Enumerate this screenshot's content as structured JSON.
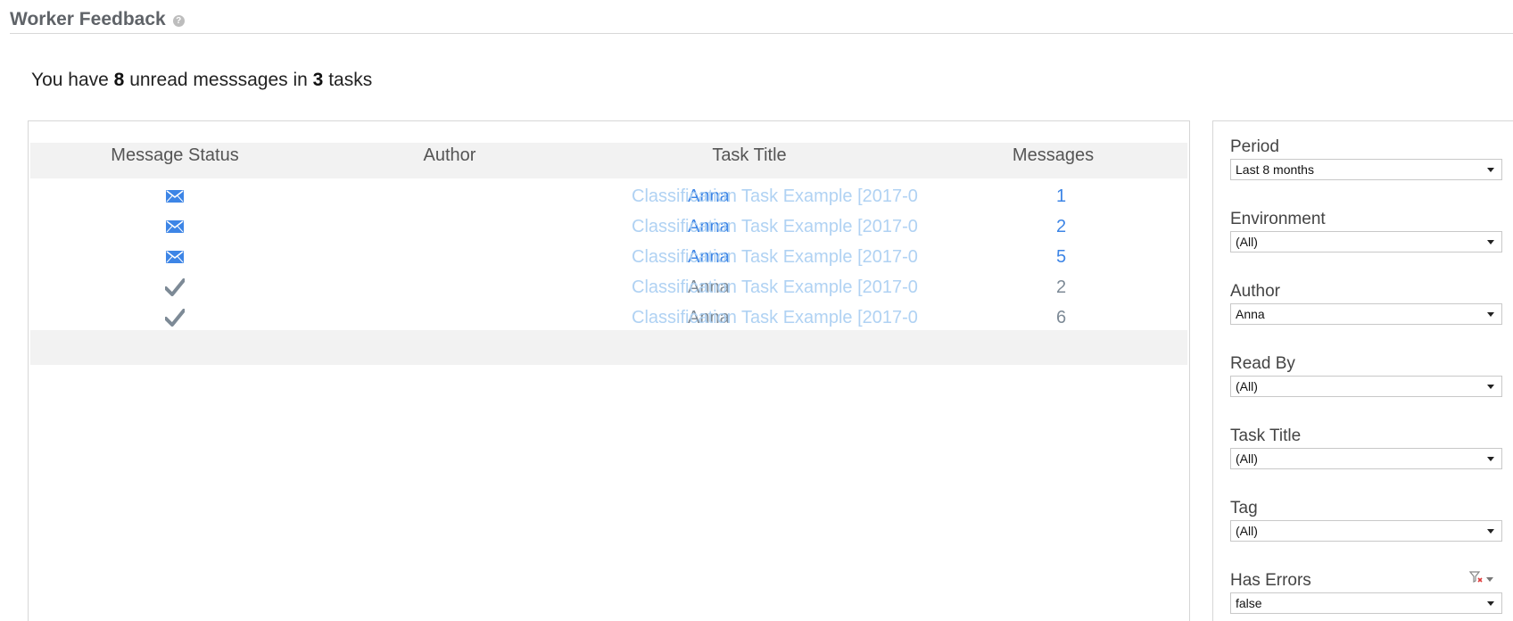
{
  "header": {
    "title": "Worker Feedback",
    "help": "?"
  },
  "summary": {
    "prefix": "You have",
    "unread_count": "8",
    "middle": "unread messsages in",
    "task_count": "3",
    "suffix": "tasks"
  },
  "table": {
    "columns": [
      "Message Status",
      "Author",
      "Task Title",
      "Messages"
    ],
    "rows": [
      {
        "status": "unread",
        "status_icon": "envelope-icon",
        "author": "Anna",
        "task": "Classification Task Example [2017-0",
        "messages": "1"
      },
      {
        "status": "unread",
        "status_icon": "envelope-icon",
        "author": "Anna",
        "task": "Classification Task Example [2017-0",
        "messages": "2"
      },
      {
        "status": "unread",
        "status_icon": "envelope-icon",
        "author": "Anna",
        "task": "Classification Task Example [2017-0",
        "messages": "5"
      },
      {
        "status": "read",
        "status_icon": "checkmark-icon",
        "author": "Anna",
        "task": "Classification Task Example [2017-0",
        "messages": "2"
      },
      {
        "status": "read",
        "status_icon": "checkmark-icon",
        "author": "Anna",
        "task": "Classification Task Example [2017-0",
        "messages": "6"
      }
    ]
  },
  "filters": [
    {
      "label": "Period",
      "value": "Last 8 months"
    },
    {
      "label": "Environment",
      "value": "(All)"
    },
    {
      "label": "Author",
      "value": "Anna"
    },
    {
      "label": "Read By",
      "value": "(All)"
    },
    {
      "label": "Task Title",
      "value": "(All)"
    },
    {
      "label": "Tag",
      "value": "(All)"
    },
    {
      "label": "Has Errors",
      "value": "false",
      "clear_icon": "clear-filter-icon"
    }
  ],
  "colors": {
    "unread_blue": "#3d85e6",
    "read_gray": "#7d8a96",
    "task_link": "#b0d2f3",
    "header_bg": "#f2f2f2"
  }
}
